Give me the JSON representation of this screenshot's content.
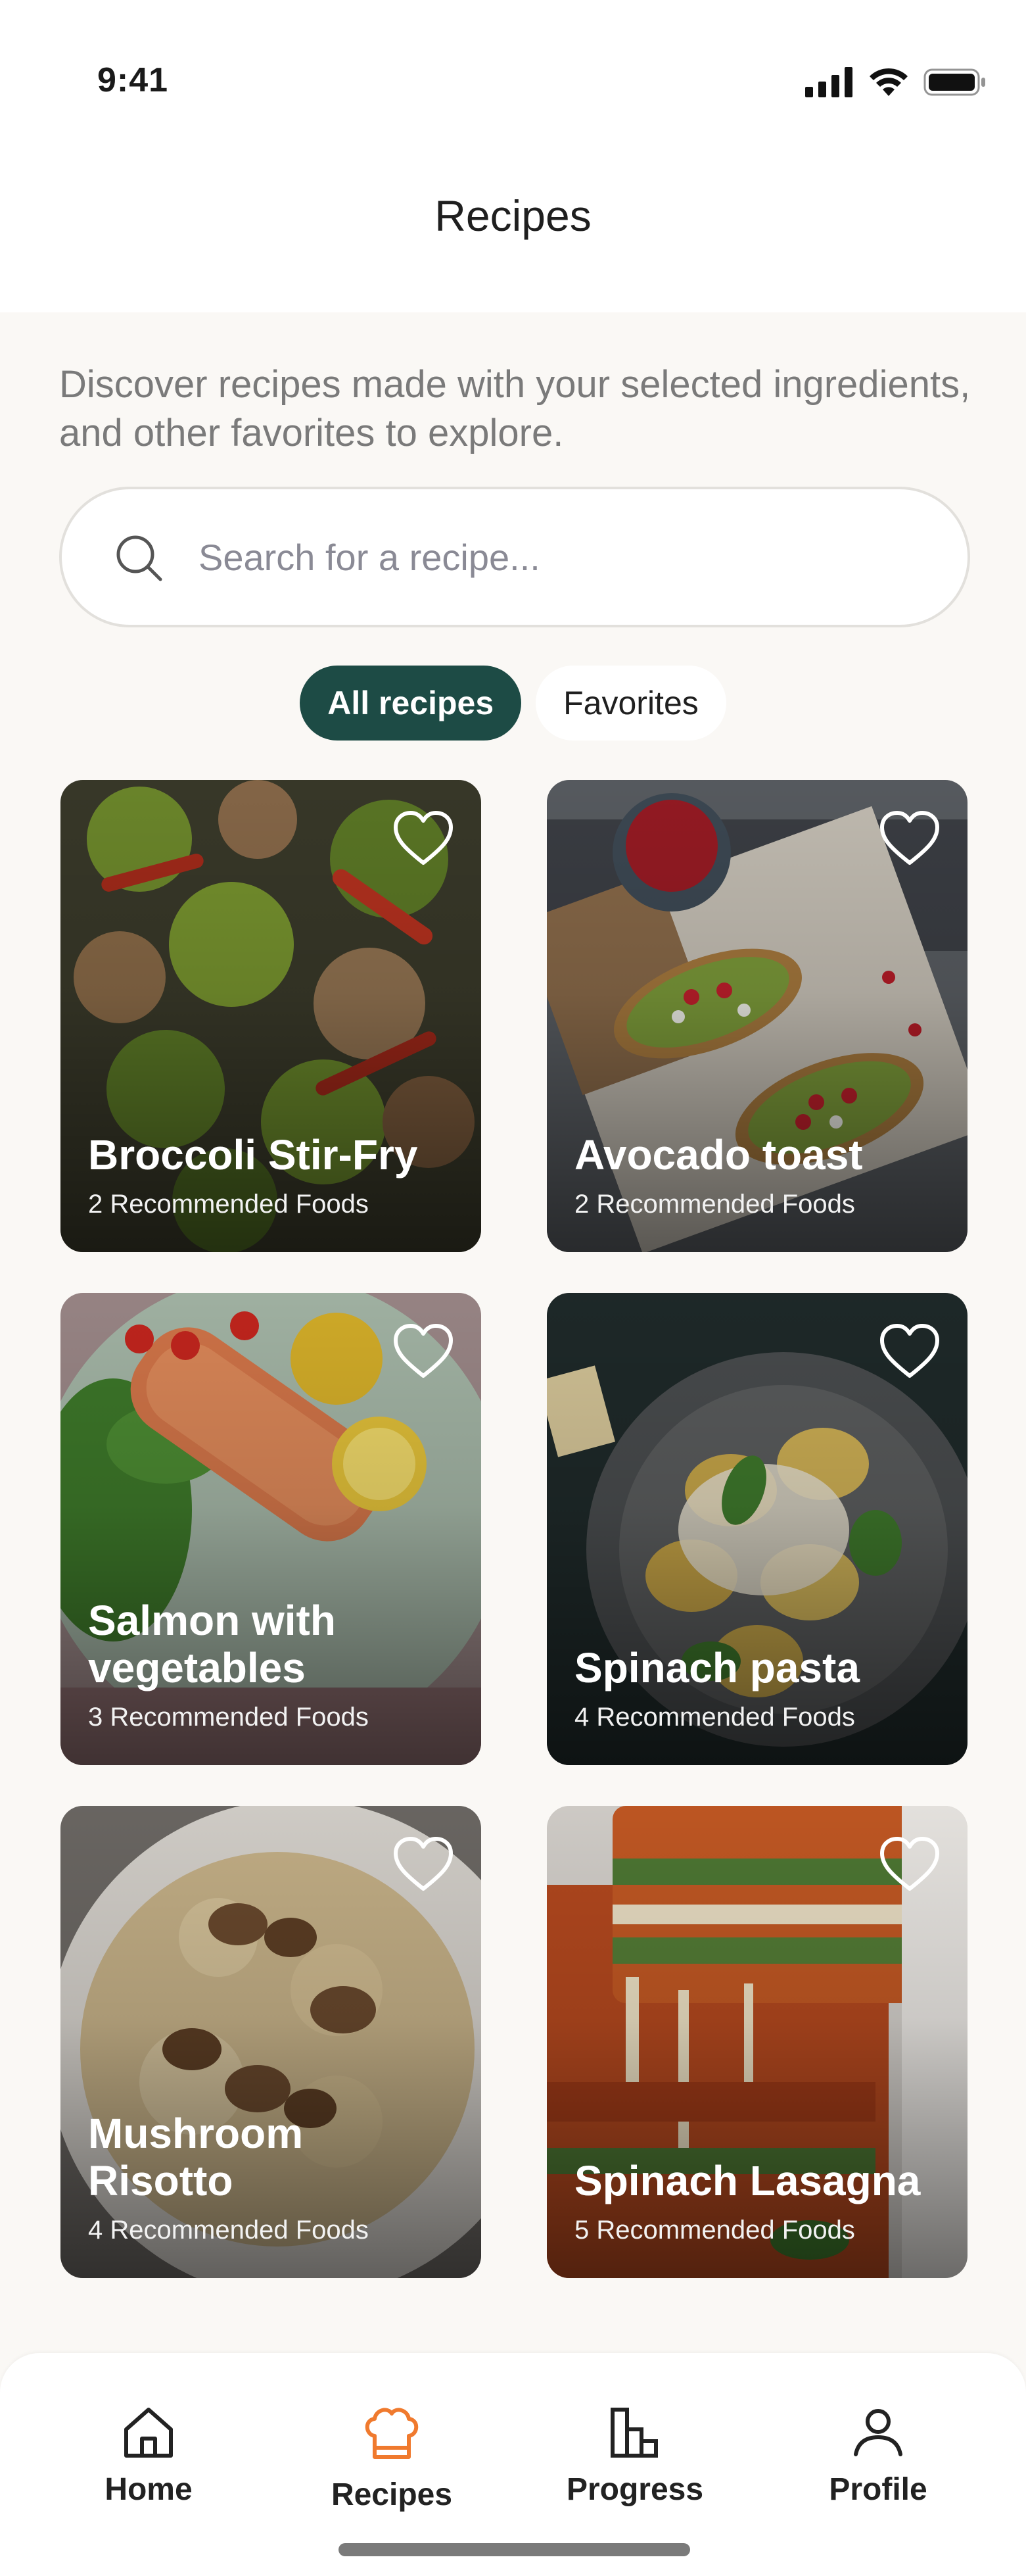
{
  "status_bar": {
    "time": "9:41"
  },
  "header": {
    "title": "Recipes"
  },
  "intro": {
    "text": "Discover recipes made with your selected ingredients, and other favorites to explore."
  },
  "search": {
    "placeholder": "Search for a recipe..."
  },
  "filters": [
    {
      "label": "All recipes",
      "active": true
    },
    {
      "label": "Favorites",
      "active": false
    }
  ],
  "recipes": [
    {
      "title": "Broccoli Stir-Fry",
      "subtitle": "2 Recommended Foods",
      "favorited": false
    },
    {
      "title": "Avocado toast",
      "subtitle": "2 Recommended Foods",
      "favorited": false
    },
    {
      "title": "Salmon with vegetables",
      "subtitle": "3 Recommended Foods",
      "favorited": false
    },
    {
      "title": "Spinach pasta",
      "subtitle": "4 Recommended Foods",
      "favorited": false
    },
    {
      "title": "Mushroom Risotto",
      "subtitle": "4 Recommended Foods",
      "favorited": false
    },
    {
      "title": "Spinach Lasagna",
      "subtitle": "5 Recommended Foods",
      "favorited": false
    }
  ],
  "tabbar": {
    "items": [
      {
        "label": "Home",
        "icon": "home-icon",
        "active": false
      },
      {
        "label": "Recipes",
        "icon": "chef-hat-icon",
        "active": true
      },
      {
        "label": "Progress",
        "icon": "chart-icon",
        "active": false
      },
      {
        "label": "Profile",
        "icon": "person-icon",
        "active": false
      }
    ]
  },
  "colors": {
    "accent": "#1d4b45",
    "active_tab_icon": "#f07a2e",
    "background": "#faf8f5"
  }
}
